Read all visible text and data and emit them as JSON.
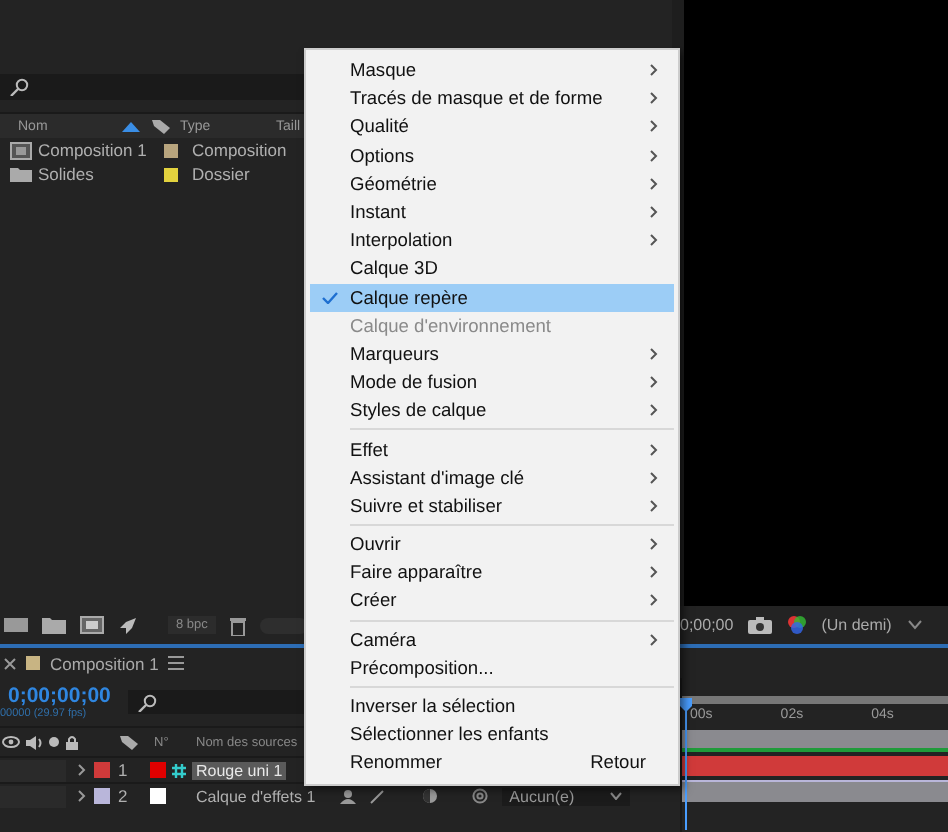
{
  "project_panel": {
    "columns": [
      "Nom",
      "Type",
      "Taill"
    ],
    "items": [
      {
        "name": "Composition 1",
        "kind": "composition",
        "color": "#b8a57e",
        "type": "Composition"
      },
      {
        "name": "Solides",
        "kind": "folder",
        "color": "#e2d23e",
        "type": "Dossier"
      }
    ],
    "bit_depth": "8 bpc"
  },
  "viewer": {
    "timecode": "0;00;00",
    "resolution": "(Un demi)"
  },
  "timeline": {
    "tab": "Composition 1",
    "timecode": "0;00;00;00",
    "frame_info": "00000 (29.97 fps)",
    "columns": [
      "N°",
      "Nom des sources"
    ],
    "ruler": [
      "00s",
      "02s",
      "04s"
    ],
    "layers": [
      {
        "number": "1",
        "name": "Rouge uni 1",
        "color": "#d03a3a",
        "kind": "solid",
        "selected": true
      },
      {
        "number": "2",
        "name": "Calque d'effets 1",
        "color": "#b9b6da",
        "kind": "adjustment",
        "selected": false,
        "parent": "Aucun(e)"
      }
    ]
  },
  "context_menu": {
    "groups": [
      [
        {
          "label": "Masque",
          "submenu": true,
          "checked": false,
          "disabled": false,
          "selected": false
        },
        {
          "label": "Tracés de masque et de forme",
          "submenu": true,
          "checked": false,
          "disabled": false,
          "selected": false
        },
        {
          "label": "Qualité",
          "submenu": true,
          "checked": false,
          "disabled": false,
          "selected": false
        },
        {
          "label": "Options",
          "submenu": true,
          "checked": false,
          "disabled": false,
          "selected": false
        },
        {
          "label": "Géométrie",
          "submenu": true,
          "checked": false,
          "disabled": false,
          "selected": false
        },
        {
          "label": "Instant",
          "submenu": true,
          "checked": false,
          "disabled": false,
          "selected": false
        },
        {
          "label": "Interpolation",
          "submenu": true,
          "checked": false,
          "disabled": false,
          "selected": false
        },
        {
          "label": "Calque 3D",
          "submenu": false,
          "checked": false,
          "disabled": false,
          "selected": false
        },
        {
          "label": "Calque repère",
          "submenu": false,
          "checked": true,
          "disabled": false,
          "selected": true
        },
        {
          "label": "Calque d'environnement",
          "submenu": false,
          "checked": false,
          "disabled": true,
          "selected": false
        },
        {
          "label": "Marqueurs",
          "submenu": true,
          "checked": false,
          "disabled": false,
          "selected": false
        },
        {
          "label": "Mode de fusion",
          "submenu": true,
          "checked": false,
          "disabled": false,
          "selected": false
        },
        {
          "label": "Styles de calque",
          "submenu": true,
          "checked": false,
          "disabled": false,
          "selected": false
        }
      ],
      [
        {
          "label": "Effet",
          "submenu": true,
          "checked": false,
          "disabled": false,
          "selected": false
        },
        {
          "label": "Assistant d'image clé",
          "submenu": true,
          "checked": false,
          "disabled": false,
          "selected": false
        },
        {
          "label": "Suivre et stabiliser",
          "submenu": true,
          "checked": false,
          "disabled": false,
          "selected": false
        }
      ],
      [
        {
          "label": "Ouvrir",
          "submenu": true,
          "checked": false,
          "disabled": false,
          "selected": false
        },
        {
          "label": "Faire apparaître",
          "submenu": true,
          "checked": false,
          "disabled": false,
          "selected": false
        },
        {
          "label": "Créer",
          "submenu": true,
          "checked": false,
          "disabled": false,
          "selected": false
        }
      ],
      [
        {
          "label": "Caméra",
          "submenu": true,
          "checked": false,
          "disabled": false,
          "selected": false
        },
        {
          "label": "Précomposition...",
          "submenu": false,
          "checked": false,
          "disabled": false,
          "selected": false
        }
      ],
      [
        {
          "label": "Inverser la sélection",
          "submenu": false,
          "checked": false,
          "disabled": false,
          "selected": false
        },
        {
          "label": "Sélectionner les enfants",
          "submenu": false,
          "checked": false,
          "disabled": false,
          "selected": false
        },
        {
          "label": "Renommer",
          "submenu": false,
          "checked": false,
          "disabled": false,
          "selected": false,
          "shortcut": "Retour"
        }
      ]
    ]
  }
}
